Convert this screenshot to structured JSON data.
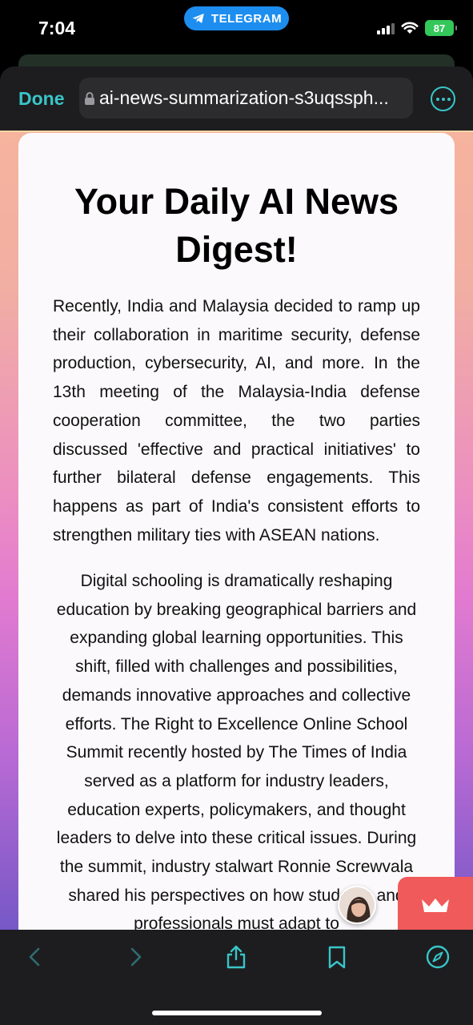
{
  "status_bar": {
    "time": "7:04",
    "telegram_label": "TELEGRAM",
    "battery": "87"
  },
  "browser": {
    "done_label": "Done",
    "url": "ai-news-summarization-s3uqssph...",
    "accent_color": "#39c5c8"
  },
  "article": {
    "title": "Your Daily AI News Digest!",
    "paragraph1": "Recently, India and Malaysia decided to ramp up their collaboration in maritime security, defense production, cybersecurity, AI, and more. In the 13th meeting of the Malaysia-India defense cooperation committee, the two parties discussed 'effective and practical initiatives' to further bilateral defense engagements. This happens as part of India's consistent efforts to strengthen military ties with ASEAN nations.",
    "paragraph2": "Digital schooling is dramatically reshaping education by breaking geographical barriers and expanding global learning opportunities. This shift, filled with challenges and possibilities, demands innovative approaches and collective efforts. The Right to Excellence Online School Summit recently hosted by The Times of India served as a platform for industry leaders, education experts, policymakers, and thought leaders to delve into these critical issues. During the summit, industry stalwart Ronnie Screwvala shared his perspectives on how students and professionals must adapt to"
  },
  "toolbar": {
    "icons": [
      "back-icon",
      "forward-icon",
      "share-icon",
      "bookmark-icon",
      "compass-icon"
    ]
  }
}
